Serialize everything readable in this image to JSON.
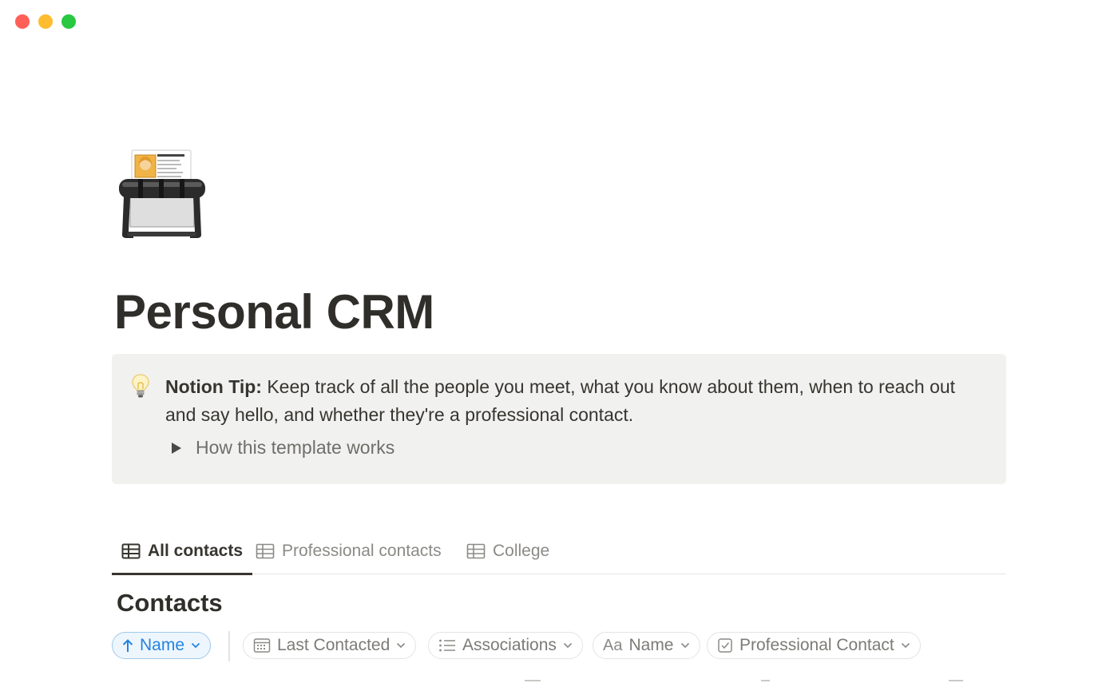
{
  "window": {
    "traffic_lights": [
      "close",
      "minimize",
      "maximize"
    ]
  },
  "page": {
    "icon": "card-file-rolodex-icon",
    "title": "Personal CRM"
  },
  "callout": {
    "icon": "lightbulb-icon",
    "bold_label": "Notion Tip:",
    "text": " Keep track of all the people you meet, what you know about them, when to reach out and say hello, and whether they're a professional contact.",
    "toggle_label": "How this template works"
  },
  "tabs": [
    {
      "label": "All contacts",
      "icon": "table-icon",
      "active": true
    },
    {
      "label": "Professional contacts",
      "icon": "table-icon",
      "active": false
    },
    {
      "label": "College",
      "icon": "table-icon",
      "active": false
    }
  ],
  "database": {
    "title": "Contacts"
  },
  "filters": {
    "sort": {
      "label": "Name",
      "icon": "arrow-up-icon"
    },
    "last_contacted": {
      "label": "Last Contacted",
      "icon": "calendar-icon"
    },
    "associations": {
      "label": "Associations",
      "icon": "list-icon"
    },
    "name": {
      "prefix": "Aa",
      "label": "Name"
    },
    "professional_contact": {
      "label": "Professional Contact",
      "icon": "checkbox-icon"
    }
  },
  "colors": {
    "accent": "#2383e2",
    "text": "#37352f",
    "callout_bg": "#f1f1ef"
  }
}
